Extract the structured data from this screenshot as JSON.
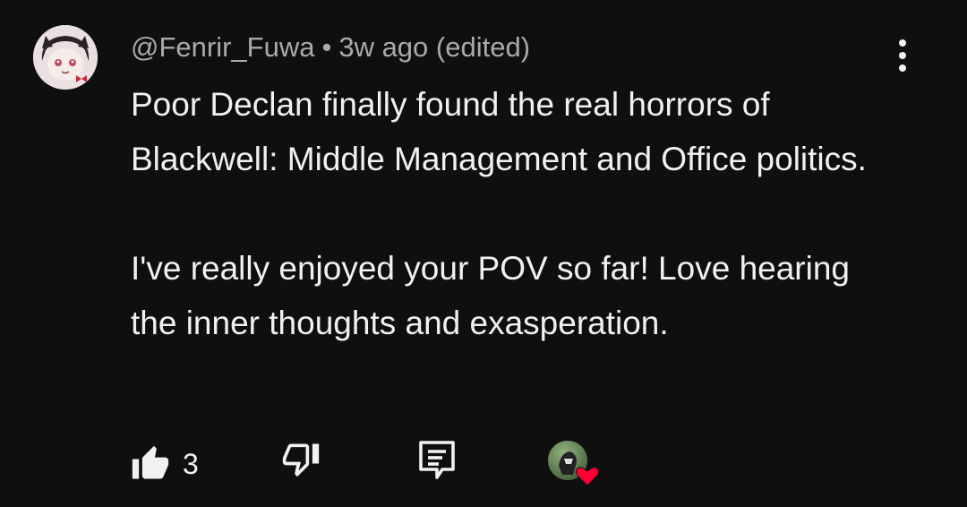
{
  "comment": {
    "author": "@Fenrir_Fuwa",
    "separator": "•",
    "time": "3w ago (edited)",
    "paragraph_1": "Poor Declan finally found the real horrors of Blackwell: Middle Management and Office politics.",
    "paragraph_2": "I've really enjoyed your POV so far! Love hearing the inner thoughts and exasperation."
  },
  "actions": {
    "like_count": "3",
    "like_icon": "thumbs-up-icon",
    "dislike_icon": "thumbs-down-icon",
    "reply_icon": "reply-icon",
    "more_icon": "more-vertical-icon"
  },
  "colors": {
    "background": "#0f0f0f",
    "text": "#f1f1f1",
    "meta": "#aaaaaa",
    "heart": "#ff0033"
  }
}
